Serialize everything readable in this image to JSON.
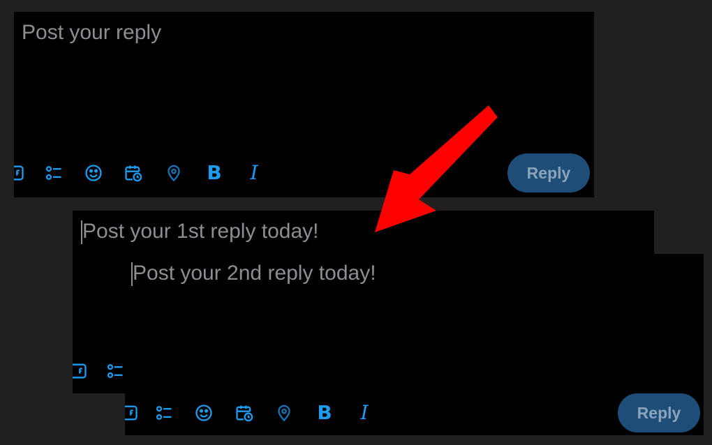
{
  "panel_top": {
    "placeholder": "Post your reply",
    "reply_label": "Reply",
    "toolbar_icons": [
      "gif-icon",
      "poll-icon",
      "emoji-icon",
      "schedule-icon",
      "location-icon",
      "bold-icon",
      "italic-icon"
    ]
  },
  "panel_middle": {
    "placeholder": "Post your 1st reply today!",
    "toolbar_icons": [
      "gif-icon",
      "poll-icon"
    ]
  },
  "panel_bottom": {
    "placeholder": "Post your 2nd reply today!",
    "reply_label": "Reply",
    "toolbar_icons": [
      "gif-icon",
      "poll-icon",
      "emoji-icon",
      "schedule-icon",
      "location-icon",
      "bold-icon",
      "italic-icon"
    ]
  },
  "toolbar": {
    "bold_glyph": "B",
    "italic_glyph": "I"
  },
  "colors": {
    "background": "#202020",
    "panel": "#000000",
    "accent": "#1d9bf0",
    "reply_button": "#1e4d78",
    "arrow": "#ff0000",
    "placeholder_text": "#8b8f94"
  }
}
